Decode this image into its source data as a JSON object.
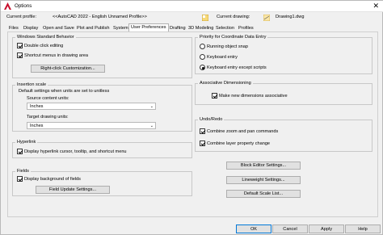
{
  "window": {
    "title": "Options",
    "close": "✕"
  },
  "profile": {
    "current_profile_label": "Current profile:",
    "current_profile_value": "<<AutoCAD 2022 - English Unnamed Profile>>",
    "current_drawing_label": "Current drawing:",
    "current_drawing_value": "Drawing1.dwg"
  },
  "tabs": [
    "Files",
    "Display",
    "Open and Save",
    "Plot and Publish",
    "System",
    "User Preferences",
    "Drafting",
    "3D Modeling",
    "Selection",
    "Profiles"
  ],
  "windows_standard": {
    "title": "Windows Standard Behavior",
    "double_click": "Double click editing",
    "shortcut_menus": "Shortcut menus in drawing area",
    "right_click_btn": "Right-click Customization..."
  },
  "insertion_scale": {
    "title": "Insertion scale",
    "subtitle": "Default settings when units are set to unitless",
    "source_label": "Source content units:",
    "source_value": "Inches",
    "target_label": "Target drawing units:",
    "target_value": "Inches"
  },
  "hyperlink": {
    "title": "Hyperlink",
    "display_cursor": "Display hyperlink cursor, tooltip, and shortcut menu"
  },
  "fields": {
    "title": "Fields",
    "display_background": "Display background of fields",
    "update_btn": "Field Update Settings..."
  },
  "priority": {
    "title": "Priority for Coordinate Data Entry",
    "running_snap": "Running object snap",
    "keyboard_entry": "Keyboard entry",
    "keyboard_except": "Keyboard entry except scripts"
  },
  "assoc_dim": {
    "title": "Associative Dimensioning",
    "make_new": "Make new dimensions associative"
  },
  "undo_redo": {
    "title": "Undo/Redo",
    "combine_zoom": "Combine zoom and pan commands",
    "combine_layer": "Combine layer property change"
  },
  "right_buttons": {
    "block_editor": "Block Editor Settings...",
    "lineweight": "Lineweight Settings...",
    "default_scale": "Default Scale List..."
  },
  "bottom": {
    "ok": "OK",
    "cancel": "Cancel",
    "apply": "Apply",
    "help": "Help"
  },
  "colors": {
    "accent": "#0078d7",
    "logo_red": "#c8102e"
  }
}
